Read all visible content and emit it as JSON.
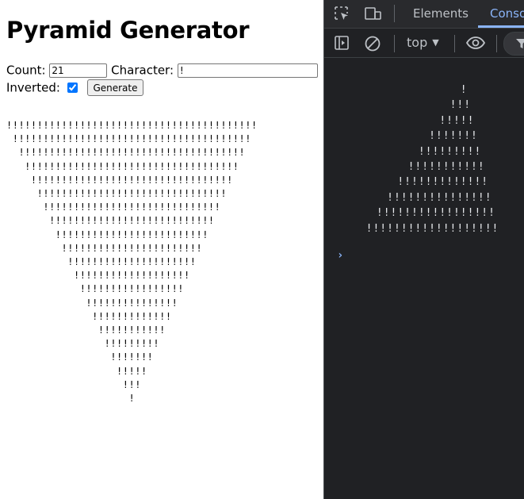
{
  "page": {
    "title": "Pyramid Generator",
    "count_label": "Count:",
    "count_value": "21",
    "character_label": "Character:",
    "character_value": "!",
    "inverted_label": "Inverted:",
    "inverted_checked": true,
    "generate_label": "Generate",
    "output_rows": 21
  },
  "devtools": {
    "tabs": [
      {
        "label": "Elements"
      },
      {
        "label": "Conso"
      }
    ],
    "active_tab": "Console",
    "context": "top",
    "console_rows": 10,
    "console_character": "!",
    "icons": [
      "inspect-icon",
      "device-toolbar-icon",
      "sidebar-icon",
      "clear-console-icon",
      "eye-icon",
      "filter-icon"
    ],
    "colors": {
      "background": "#202124",
      "accent": "#8ab4f8",
      "text": "#e8eaed"
    }
  }
}
